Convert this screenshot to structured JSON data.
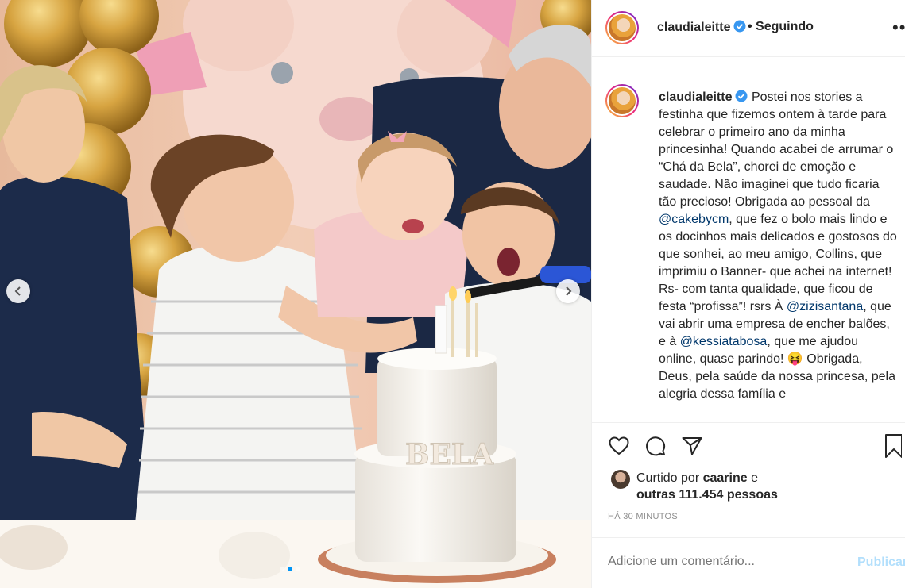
{
  "post": {
    "username": "claudialeitte",
    "follow_status": "Seguindo",
    "more_glyph": "•••",
    "caption_parts": [
      "Postei nos stories a festinha que fizemos ontem à tarde para celebrar o primeiro ano da minha princesinha! Quando acabei de arrumar o “Chá da Bela”, chorei de emoção e saudade. Não imaginei que tudo ficaria tão precioso! Obrigada ao pessoal da ",
      "@cakebycm",
      ", que fez o bolo mais lindo e os docinhos mais delicados e gostosos do que sonhei, ao meu amigo, Collins, que imprimiu o Banner- que achei na internet! Rs- com tanta qualidade, que ficou de festa “profissa”! rsrs À ",
      "@zizisantana",
      ", que vai abrir uma empresa de encher balões, e à ",
      "@kessiatabosa",
      ", que me ajudou online, quase parindo! 😝 Obrigada, Deus, pela saúde da nossa princesa, pela alegria dessa família e"
    ],
    "liked_prefix": "Curtido por ",
    "liked_user": "caarine",
    "liked_and": " e",
    "liked_others": "outras 111.454 pessoas",
    "timestamp": "HÁ 30 MINUTOS",
    "comment_placeholder": "Adicione um comentário...",
    "publish_label": "Publicar",
    "cake_text": "BELA",
    "carousel": {
      "count": 3,
      "active": 2
    }
  },
  "colors": {
    "accent": "#0095f6",
    "link": "#00376b",
    "muted": "#8e8e8e",
    "publish_disabled": "#b2dffc"
  },
  "icons": [
    "verified-badge-icon",
    "heart-icon",
    "comment-icon",
    "share-icon",
    "bookmark-icon",
    "chevron-left-icon",
    "chevron-right-icon"
  ]
}
